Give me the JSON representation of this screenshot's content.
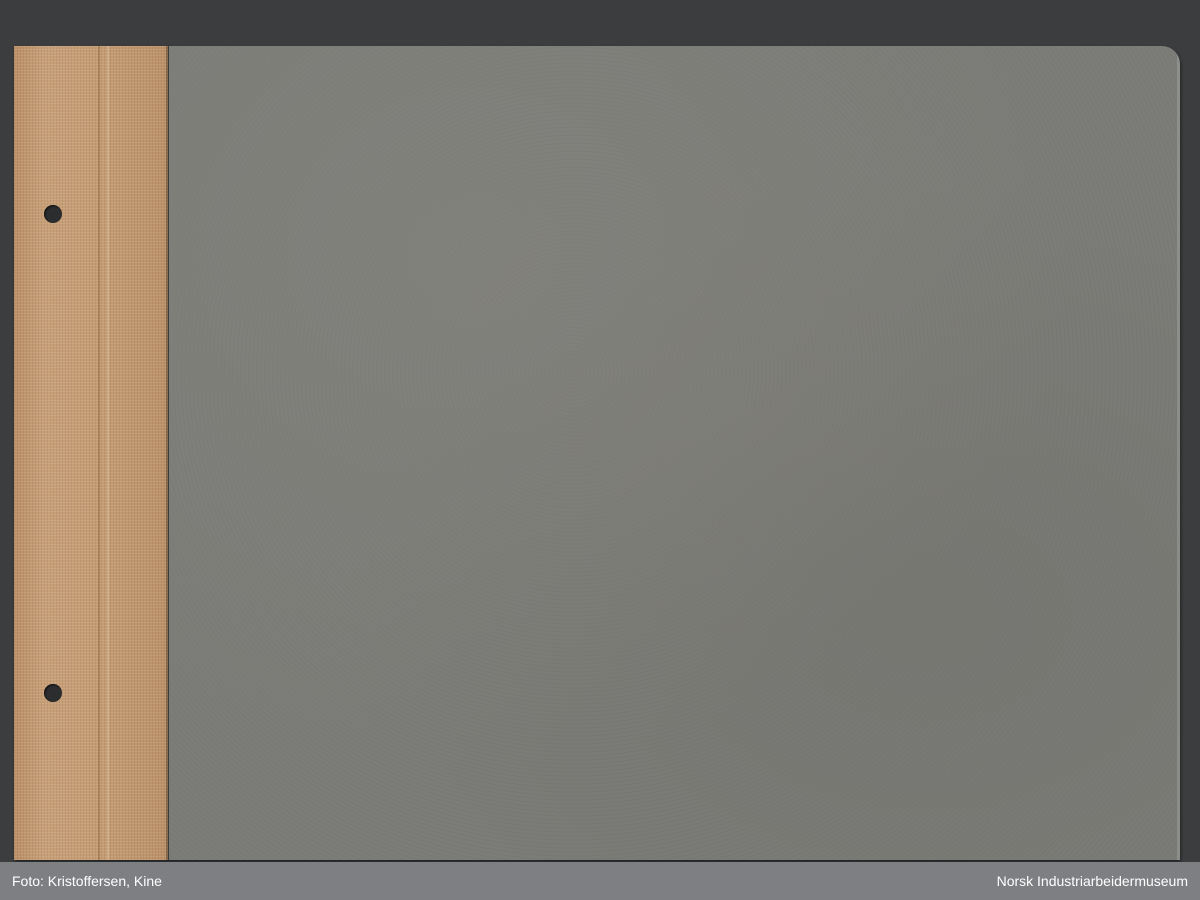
{
  "photo": {
    "subject": "photo-album-cover",
    "colors": {
      "background": "#3b3d3f",
      "spine_cloth": "#c19a70",
      "cover_board": "#7c7c78",
      "footer_bar": "#7d7f82"
    }
  },
  "footer": {
    "photographer": "Foto: Kristoffersen, Kine",
    "institution": "Norsk Industriarbeidermuseum"
  }
}
